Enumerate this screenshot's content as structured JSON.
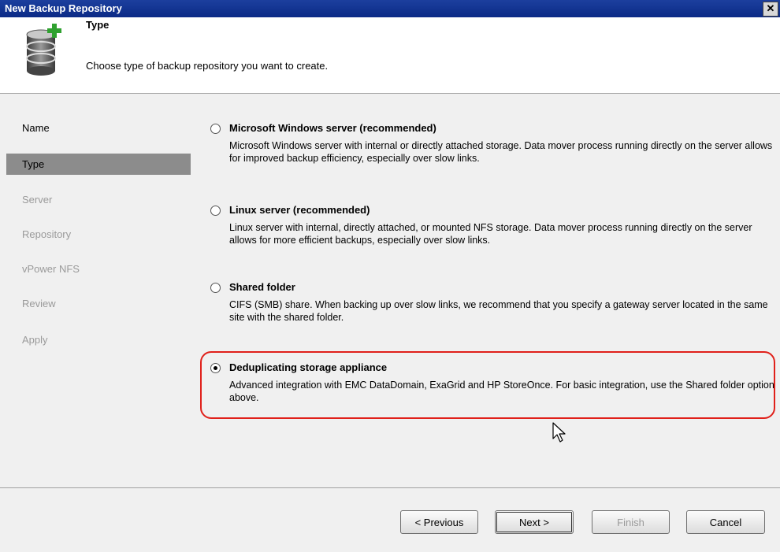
{
  "window": {
    "title": "New Backup Repository",
    "close_label": "✕"
  },
  "header": {
    "title": "Type",
    "description": "Choose type of backup repository you want to create.",
    "icon": "database-add-icon"
  },
  "sidebar": {
    "steps": [
      {
        "label": "Name",
        "state": "done"
      },
      {
        "label": "Type",
        "state": "active"
      },
      {
        "label": "Server",
        "state": "pending"
      },
      {
        "label": "Repository",
        "state": "pending"
      },
      {
        "label": "vPower NFS",
        "state": "pending"
      },
      {
        "label": "Review",
        "state": "pending"
      },
      {
        "label": "Apply",
        "state": "pending"
      }
    ]
  },
  "options": [
    {
      "label": "Microsoft Windows server (recommended)",
      "description": "Microsoft Windows server with internal or directly attached storage. Data mover process running directly on the server allows for improved backup efficiency, especially over slow links.",
      "selected": false
    },
    {
      "label": "Linux server (recommended)",
      "description": "Linux server with internal, directly attached, or mounted NFS storage. Data mover process running directly on the server allows for more efficient backups, especially over slow links.",
      "selected": false
    },
    {
      "label": "Shared folder",
      "description": "CIFS (SMB) share. When backing up over slow links, we recommend that you specify a gateway server located in the same site with the shared folder.",
      "selected": false
    },
    {
      "label": "Deduplicating storage appliance",
      "description": "Advanced integration with EMC DataDomain, ExaGrid and HP StoreOnce. For basic integration, use the Shared folder option above.",
      "selected": true
    }
  ],
  "footer": {
    "previous": "< Previous",
    "next": "Next >",
    "finish": "Finish",
    "cancel": "Cancel"
  },
  "colors": {
    "titlebar": "#0b2a86",
    "active_step": "#8c8c8c",
    "highlight": "#e0201a"
  }
}
